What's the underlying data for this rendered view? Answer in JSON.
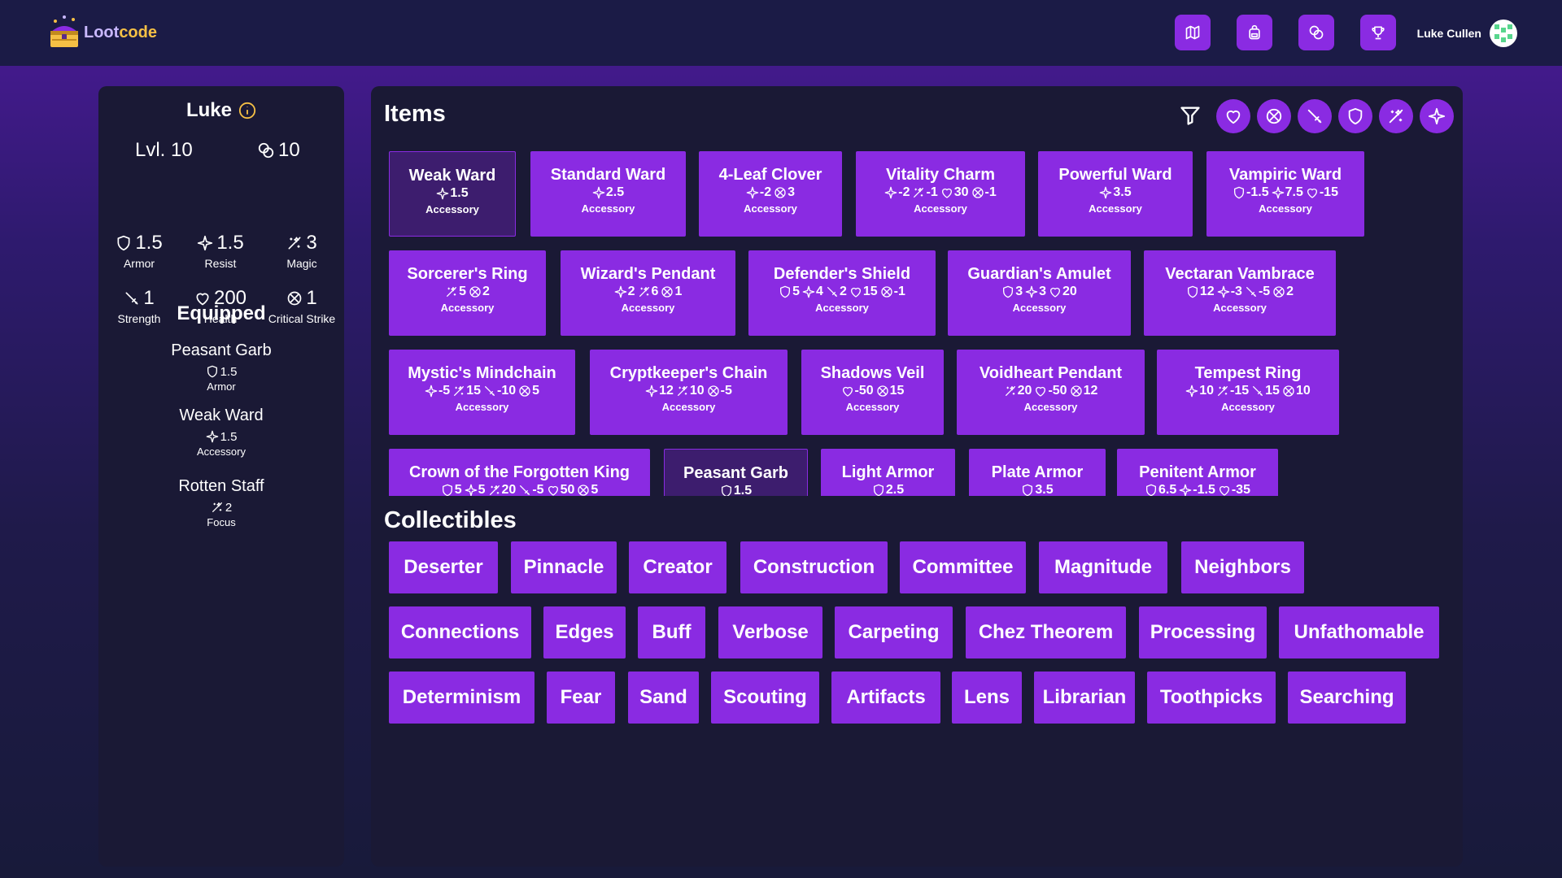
{
  "app": {
    "name_part1": "Loot",
    "name_part2": "code"
  },
  "header": {
    "nav": [
      {
        "name": "map",
        "icon": "map-icon"
      },
      {
        "name": "backpack",
        "icon": "backpack-icon"
      },
      {
        "name": "coins",
        "icon": "coins-icon"
      },
      {
        "name": "trophy",
        "icon": "trophy-icon"
      }
    ],
    "user_name": "Luke Cullen"
  },
  "character": {
    "name": "Luke",
    "level": "Lvl. 10",
    "coins": "10",
    "stats": [
      {
        "icon": "shield-icon",
        "value": "1.5",
        "label": "Armor"
      },
      {
        "icon": "sparkle-icon",
        "value": "1.5",
        "label": "Resist"
      },
      {
        "icon": "magic-wand-icon",
        "value": "3",
        "label": "Magic"
      },
      {
        "icon": "sword-icon",
        "value": "1",
        "label": "Strength"
      },
      {
        "icon": "heart-icon",
        "value": "200",
        "label": "Health"
      },
      {
        "icon": "crit-icon",
        "value": "1",
        "label": "Critical Strike"
      }
    ],
    "equipped_title": "Equipped",
    "equipped": [
      {
        "name": "Peasant Garb",
        "stat_icon": "shield-icon",
        "stat": "1.5",
        "type": "Armor"
      },
      {
        "name": "Weak Ward",
        "stat_icon": "sparkle-icon",
        "stat": "1.5",
        "type": "Accessory"
      },
      {
        "name": "Rotten Staff",
        "stat_icon": "magic-wand-icon",
        "stat": "2",
        "type": "Focus"
      }
    ]
  },
  "items_section": {
    "title": "Items",
    "filters": [
      "heart-icon",
      "crit-icon",
      "sword-icon",
      "shield-icon",
      "magic-wand-icon",
      "sparkle-icon"
    ],
    "items": [
      {
        "name": "Weak Ward",
        "type": "Accessory",
        "equipped": true,
        "stats": [
          [
            "sparkle-icon",
            "1.5"
          ]
        ]
      },
      {
        "name": "Standard Ward",
        "type": "Accessory",
        "stats": [
          [
            "sparkle-icon",
            "2.5"
          ]
        ]
      },
      {
        "name": "4-Leaf Clover",
        "type": "Accessory",
        "stats": [
          [
            "sparkle-icon",
            "-2"
          ],
          [
            "crit-icon",
            "3"
          ]
        ]
      },
      {
        "name": "Vitality Charm",
        "type": "Accessory",
        "stats": [
          [
            "sparkle-icon",
            "-2"
          ],
          [
            "magic-wand-icon",
            "-1"
          ],
          [
            "heart-icon",
            "30"
          ],
          [
            "crit-icon",
            "-1"
          ]
        ]
      },
      {
        "name": "Powerful Ward",
        "type": "Accessory",
        "stats": [
          [
            "sparkle-icon",
            "3.5"
          ]
        ]
      },
      {
        "name": "Vampiric Ward",
        "type": "Accessory",
        "stats": [
          [
            "shield-icon",
            "-1.5"
          ],
          [
            "sparkle-icon",
            "7.5"
          ],
          [
            "heart-icon",
            "-15"
          ]
        ]
      },
      {
        "name": "Sorcerer's Ring",
        "type": "Accessory",
        "stats": [
          [
            "magic-wand-icon",
            "5"
          ],
          [
            "crit-icon",
            "2"
          ]
        ]
      },
      {
        "name": "Wizard's Pendant",
        "type": "Accessory",
        "stats": [
          [
            "sparkle-icon",
            "2"
          ],
          [
            "magic-wand-icon",
            "6"
          ],
          [
            "crit-icon",
            "1"
          ]
        ]
      },
      {
        "name": "Defender's Shield",
        "type": "Accessory",
        "stats": [
          [
            "shield-icon",
            "5"
          ],
          [
            "sparkle-icon",
            "4"
          ],
          [
            "sword-icon",
            "2"
          ],
          [
            "heart-icon",
            "15"
          ],
          [
            "crit-icon",
            "-1"
          ]
        ]
      },
      {
        "name": "Guardian's Amulet",
        "type": "Accessory",
        "stats": [
          [
            "shield-icon",
            "3"
          ],
          [
            "sparkle-icon",
            "3"
          ],
          [
            "heart-icon",
            "20"
          ]
        ]
      },
      {
        "name": "Vectaran Vambrace",
        "type": "Accessory",
        "stats": [
          [
            "shield-icon",
            "12"
          ],
          [
            "sparkle-icon",
            "-3"
          ],
          [
            "sword-icon",
            "-5"
          ],
          [
            "crit-icon",
            "2"
          ]
        ]
      },
      {
        "name": "Mystic's Mindchain",
        "type": "Accessory",
        "stats": [
          [
            "sparkle-icon",
            "-5"
          ],
          [
            "magic-wand-icon",
            "15"
          ],
          [
            "sword-icon",
            "-10"
          ],
          [
            "crit-icon",
            "5"
          ]
        ]
      },
      {
        "name": "Cryptkeeper's Chain",
        "type": "Accessory",
        "stats": [
          [
            "sparkle-icon",
            "12"
          ],
          [
            "magic-wand-icon",
            "10"
          ],
          [
            "crit-icon",
            "-5"
          ]
        ]
      },
      {
        "name": "Shadows Veil",
        "type": "Accessory",
        "stats": [
          [
            "heart-icon",
            "-50"
          ],
          [
            "crit-icon",
            "15"
          ]
        ]
      },
      {
        "name": "Voidheart Pendant",
        "type": "Accessory",
        "stats": [
          [
            "magic-wand-icon",
            "20"
          ],
          [
            "heart-icon",
            "-50"
          ],
          [
            "crit-icon",
            "12"
          ]
        ]
      },
      {
        "name": "Tempest Ring",
        "type": "Accessory",
        "stats": [
          [
            "sparkle-icon",
            "10"
          ],
          [
            "magic-wand-icon",
            "-15"
          ],
          [
            "sword-icon",
            "15"
          ],
          [
            "crit-icon",
            "10"
          ]
        ]
      },
      {
        "name": "Crown of the Forgotten King",
        "type": "",
        "stats": [
          [
            "shield-icon",
            "5"
          ],
          [
            "sparkle-icon",
            "5"
          ],
          [
            "magic-wand-icon",
            "20"
          ],
          [
            "sword-icon",
            "-5"
          ],
          [
            "heart-icon",
            "50"
          ],
          [
            "crit-icon",
            "5"
          ]
        ]
      },
      {
        "name": "Peasant Garb",
        "type": "",
        "equipped": true,
        "stats": [
          [
            "shield-icon",
            "1.5"
          ]
        ]
      },
      {
        "name": "Light Armor",
        "type": "",
        "stats": [
          [
            "shield-icon",
            "2.5"
          ]
        ]
      },
      {
        "name": "Plate Armor",
        "type": "",
        "stats": [
          [
            "shield-icon",
            "3.5"
          ]
        ]
      },
      {
        "name": "Penitent Armor",
        "type": "",
        "stats": [
          [
            "shield-icon",
            "6.5"
          ],
          [
            "sparkle-icon",
            "-1.5"
          ],
          [
            "heart-icon",
            "-35"
          ]
        ]
      }
    ]
  },
  "collectibles_section": {
    "title": "Collectibles",
    "items": [
      "Deserter",
      "Pinnacle",
      "Creator",
      "Construction",
      "Committee",
      "Magnitude",
      "Neighbors",
      "Connections",
      "Edges",
      "Buff",
      "Verbose",
      "Carpeting",
      "Chez Theorem",
      "Processing",
      "Unfathomable",
      "Determinism",
      "Fear",
      "Sand",
      "Scouting",
      "Artifacts",
      "Lens",
      "Librarian",
      "Toothpicks",
      "Searching"
    ]
  }
}
